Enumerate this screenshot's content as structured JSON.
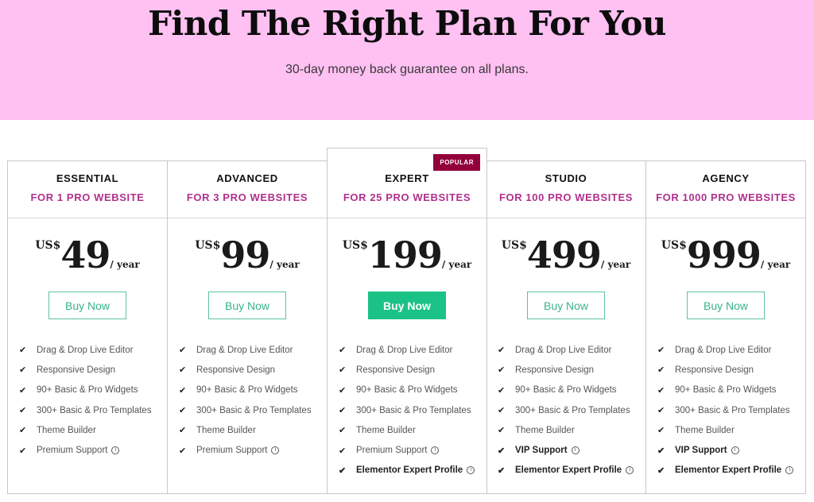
{
  "hero": {
    "title": "Find The Right Plan For You",
    "subtitle": "30-day money back guarantee on all plans.",
    "background_color": "#ffc0f2"
  },
  "colors": {
    "accent_green": "#1bc285",
    "sites_text": "#b0308c",
    "badge_bg": "#92003b"
  },
  "plans": [
    {
      "name": "ESSENTIAL",
      "sites": "FOR 1 PRO WEBSITE",
      "currency": "US$",
      "amount": "49",
      "period": "/ year",
      "button": "Buy Now",
      "featured": false,
      "features": [
        {
          "label": "Drag & Drop Live Editor",
          "strong": false,
          "info": false
        },
        {
          "label": "Responsive Design",
          "strong": false,
          "info": false
        },
        {
          "label": "90+ Basic & Pro Widgets",
          "strong": false,
          "info": false
        },
        {
          "label": "300+ Basic & Pro Templates",
          "strong": false,
          "info": false
        },
        {
          "label": "Theme Builder",
          "strong": false,
          "info": false
        },
        {
          "label": "Premium Support",
          "strong": false,
          "info": true
        }
      ]
    },
    {
      "name": "ADVANCED",
      "sites": "FOR 3 PRO WEBSITES",
      "currency": "US$",
      "amount": "99",
      "period": "/ year",
      "button": "Buy Now",
      "featured": false,
      "features": [
        {
          "label": "Drag & Drop Live Editor",
          "strong": false,
          "info": false
        },
        {
          "label": "Responsive Design",
          "strong": false,
          "info": false
        },
        {
          "label": "90+ Basic & Pro Widgets",
          "strong": false,
          "info": false
        },
        {
          "label": "300+ Basic & Pro Templates",
          "strong": false,
          "info": false
        },
        {
          "label": "Theme Builder",
          "strong": false,
          "info": false
        },
        {
          "label": "Premium Support",
          "strong": false,
          "info": true
        }
      ]
    },
    {
      "name": "EXPERT",
      "sites": "FOR 25 PRO WEBSITES",
      "badge": "POPULAR",
      "currency": "US$",
      "amount": "199",
      "period": "/ year",
      "button": "Buy Now",
      "featured": true,
      "features": [
        {
          "label": "Drag & Drop Live Editor",
          "strong": false,
          "info": false
        },
        {
          "label": "Responsive Design",
          "strong": false,
          "info": false
        },
        {
          "label": "90+ Basic & Pro Widgets",
          "strong": false,
          "info": false
        },
        {
          "label": "300+ Basic & Pro Templates",
          "strong": false,
          "info": false
        },
        {
          "label": "Theme Builder",
          "strong": false,
          "info": false
        },
        {
          "label": "Premium Support",
          "strong": false,
          "info": true
        },
        {
          "label": "Elementor Expert Profile",
          "strong": true,
          "info": true
        }
      ]
    },
    {
      "name": "STUDIO",
      "sites": "FOR 100 PRO WEBSITES",
      "currency": "US$",
      "amount": "499",
      "period": "/ year",
      "button": "Buy Now",
      "featured": false,
      "features": [
        {
          "label": "Drag & Drop Live Editor",
          "strong": false,
          "info": false
        },
        {
          "label": "Responsive Design",
          "strong": false,
          "info": false
        },
        {
          "label": "90+ Basic & Pro Widgets",
          "strong": false,
          "info": false
        },
        {
          "label": "300+ Basic & Pro Templates",
          "strong": false,
          "info": false
        },
        {
          "label": "Theme Builder",
          "strong": false,
          "info": false
        },
        {
          "label": "VIP Support",
          "strong": true,
          "info": true
        },
        {
          "label": "Elementor Expert Profile",
          "strong": true,
          "info": true
        }
      ]
    },
    {
      "name": "AGENCY",
      "sites": "FOR 1000 PRO WEBSITES",
      "currency": "US$",
      "amount": "999",
      "period": "/ year",
      "button": "Buy Now",
      "featured": false,
      "features": [
        {
          "label": "Drag & Drop Live Editor",
          "strong": false,
          "info": false
        },
        {
          "label": "Responsive Design",
          "strong": false,
          "info": false
        },
        {
          "label": "90+ Basic & Pro Widgets",
          "strong": false,
          "info": false
        },
        {
          "label": "300+ Basic & Pro Templates",
          "strong": false,
          "info": false
        },
        {
          "label": "Theme Builder",
          "strong": false,
          "info": false
        },
        {
          "label": "VIP Support",
          "strong": true,
          "info": true
        },
        {
          "label": "Elementor Expert Profile",
          "strong": true,
          "info": true
        }
      ]
    }
  ],
  "icons": {
    "check": "✔",
    "info": "i"
  }
}
